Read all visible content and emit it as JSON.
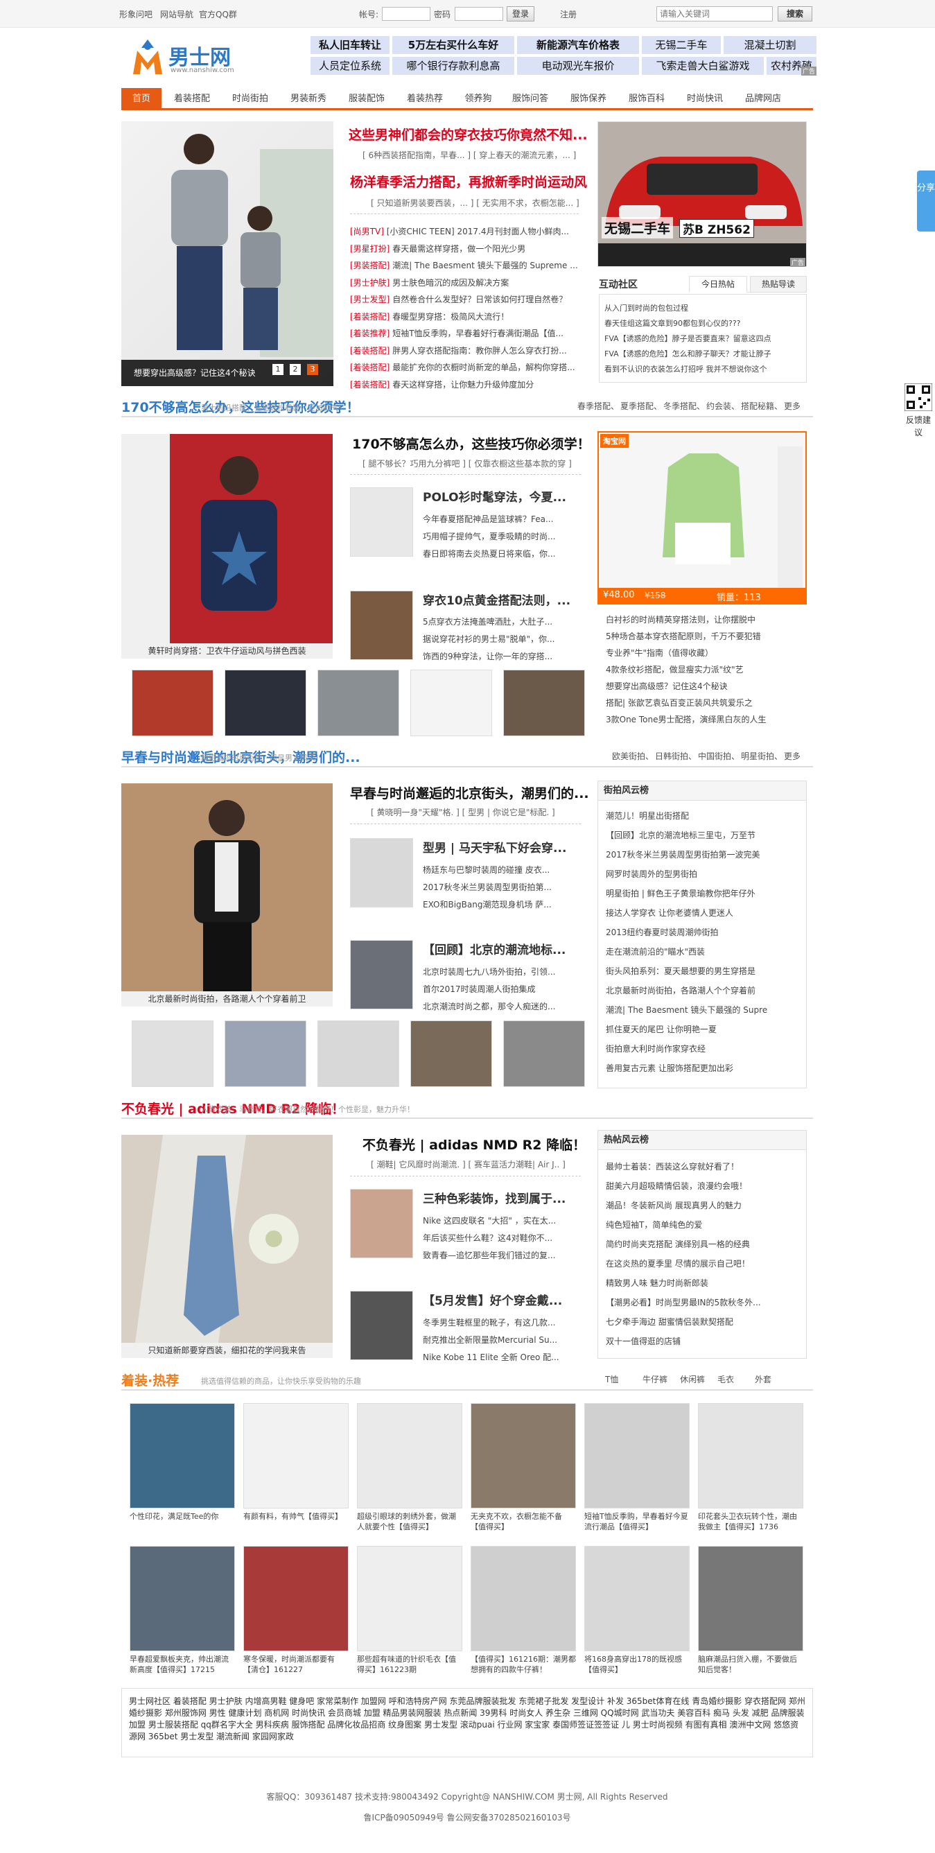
{
  "topbar": {
    "links": [
      "形象问吧",
      "网站导航",
      "官方QQ群"
    ],
    "account_label": "帐号:",
    "password_label": "密码",
    "login_btn": "登录",
    "register": "注册",
    "search_placeholder": "请输入关键词",
    "search_btn": "搜索"
  },
  "logo": {
    "text": "男士网",
    "sub": "www.nanshiw.com"
  },
  "hotlinks": [
    "私人旧车转让",
    "5万左右买什么车好",
    "新能源汽车价格表",
    "无锡二手车",
    "混凝土切割",
    "人员定位系统",
    "哪个银行存款利息高",
    "电动观光车报价",
    "飞索走兽大白鲨游戏",
    "农村养殖"
  ],
  "hot_ad": "广告",
  "nav": [
    "首页",
    "着装搭配",
    "时尚街拍",
    "男装新秀",
    "服装配饰",
    "着装热荐",
    "领养狗",
    "服饰问答",
    "服饰保养",
    "服饰百科",
    "时尚快讯",
    "品牌网店"
  ],
  "hero": {
    "caption": "想要穿出高级感？记住这4个秘诀",
    "dots": [
      "1",
      "2",
      "3"
    ],
    "title1": "这些男神们都会的穿衣技巧你竟然不知...",
    "sub1": "[ 6种西装搭配指南，早春... ]  [ 穿上春天的潮流元素，... ]",
    "title2": "杨洋春季活力搭配，再掀新季时尚运动风",
    "sub2": "[ 只知道新男装要西装，... ]  [ 无实用不求，衣橱怎能... ]",
    "items": [
      [
        "[尚男TV]",
        "[小资CHIC TEEN] 2017.4月刊封面人物小鲜肉..."
      ],
      [
        "[男星打扮]",
        "春天最需这样穿搭，做一个阳光少男"
      ],
      [
        "[男装搭配]",
        "潮流| The Baesment 镜头下最强的 Supreme ..."
      ],
      [
        "[男士护肤]",
        "男士肤色暗沉的成因及解决方案"
      ],
      [
        "[男士发型]",
        "自然卷合什么发型好？日常该如何打理自然卷？"
      ],
      [
        "[着装搭配]",
        "春暖型男穿搭：极简风大流行！"
      ],
      [
        "[着装推荐]",
        "短袖T恤反季购，早春着好行春满街潮品【值..."
      ],
      [
        "[着装搭配]",
        "胖男人穿衣搭配指南：教你胖人怎么穿衣打扮..."
      ],
      [
        "[着装搭配]",
        "最能扩充你的衣橱时尚新宠的单品，解构你穿搭..."
      ],
      [
        "[着装搭配]",
        "春天这样穿搭，让你魅力升级帅度加分"
      ]
    ]
  },
  "car": {
    "label": "无锡二手车",
    "plate": "苏B ZH562",
    "ad": "广告"
  },
  "community": {
    "title": "互动社区",
    "tabs": [
      "今日热帖",
      "热贴导读"
    ],
    "items": [
      "从入门到时尚的包包过程",
      "春天佳组这篇文章到90都包到心仪的???",
      "FVA【诱惑的危险】脖子是否要直来？留意这四点",
      "FVA【诱惑的危险】怎么和脖子聊天？才能让脖子",
      "看到不认识的衣装怎么打招呼 我并不想说你这个"
    ]
  },
  "s1": {
    "title": "170不够高怎么办，这些技巧你必须学！",
    "subtitle": "男士前沿搭配，让您轻松着装，更加帅气！",
    "links": [
      "春季搭配、",
      "夏季搭配、",
      "冬季搭配、",
      "约会装、",
      "搭配秘籍、",
      "更多"
    ],
    "main_cap": "黄轩时尚穿搭：卫衣牛仔运动风与拼色西装",
    "sub": "[ 腿不够长？巧用九分裤吧 ]  [ 仅靠衣橱这些基本款的穿 ]",
    "a1": {
      "title": "POLO衫时髦穿法，今夏...",
      "items": [
        "今年春夏搭配神品是篮球裤？Fea...",
        "巧用帽子提帅气，夏季吸睛的时尚...",
        "春日即将南去炎热夏日将来临，你..."
      ]
    },
    "a2": {
      "title": "穿衣10点黄金搭配法则，...",
      "items": [
        "5点穿衣方法掩盖啤酒肚，大肚子...",
        "据说穿花衬衫的男士易\"脱单\"，你...",
        "饰西的9种穿法，让你一年的穿搭..."
      ]
    },
    "taobao": {
      "logo": "淘宝网",
      "price": "¥48.00",
      "old": "¥158",
      "sales": "销量：113",
      "ad": "广告"
    },
    "right_list": [
      "白衬衫的时尚精英穿搭法则，让你摆脱中",
      "5种场合基本穿衣搭配原则，千万不要犯错",
      "专业养\"牛\"指南（值得收藏）",
      "4款条纹衫搭配，做显瘦实力派\"纹\"艺",
      "想要穿出高级感？记住这4个秘诀",
      "搭配| 张歆艺袁弘百变正装风共筑爱乐之",
      "3款One Tone男士配搭，演绎黑白灰的人生"
    ]
  },
  "s2": {
    "title": "早春与时尚邂逅的北京街头，潮男们的...",
    "subtitle": "精彩潮流时尚街拍，尽显男人风采！",
    "links": [
      "欧美街拍、",
      "日韩街拍、",
      "中国街拍、",
      "明星街拍、",
      "更多"
    ],
    "main_cap": "北京最新时尚街拍，各路潮人个个穿着前卫",
    "sub": "[ 黄晓明一身\"天耀\"格. ]  [ 型男 | 你说它是\"标配. ]",
    "a1": {
      "title": "型男 | 马天宇私下好会穿...",
      "items": [
        "杨廷东与巴黎时装周的碰撞 皮衣...",
        "2017秋冬米兰男装周型男街拍第...",
        "EXO和BigBang潮范现身机场 萨..."
      ]
    },
    "a2": {
      "title": "【回顾】北京的潮流地标...",
      "items": [
        "北京时装周七九八场外街拍，引领...",
        "首尔2017时装周潮人街拍集成",
        "北京潮流时尚之都，那令人痴迷的..."
      ]
    },
    "box_title": "街拍风云榜",
    "box_items": [
      "潮范儿！明星出街搭配",
      "【回顾】北京的潮流地标三里屯，万至节",
      "2017秋冬米兰男装周型男街拍第一波完美",
      "网罗时装周外的型男街拍",
      "明星街拍 | 鲜色王子黄景瑜教你把年仔外",
      "接达人学穿衣 让你老婆情人更迷人",
      "2013纽约春夏时装周潮帅街拍",
      "走在潮流前沿的\"瞄水\"西装",
      "街头风拍系列：夏天最想要的男生穿搭是",
      "北京最新时尚街拍，各路潮人个个穿着前",
      "潮流| The Baesment 镜头下最强的 Supre",
      "抓住夏天的尾巴 让你明艳一夏",
      "街拍意大利时尚作家穿衣经",
      "善用复古元素 让服饰搭配更加出彩"
    ]
  },
  "s3": {
    "title": "不负春光 | adidas NMD R2 降临！",
    "subtitle": "人靠衣装，马靠鞍。好衣服自然好配饰！个性彰显，魅力升华！",
    "main_cap": "只知道新郎要穿西装，细扣花的学问我来告",
    "sub": "[ 潮鞋| 它风靡时尚潮流. ]  [ 赛车蓝活力潮鞋| Air J.. ]",
    "a1": {
      "title": "三种色彩装饰，找到属于...",
      "items": [
        "Nike 这四皮联名 \"大招\" ，实在太...",
        "年后该买些什么鞋？这4对鞋你不...",
        "致青春—追忆那些年我们错过的复..."
      ]
    },
    "a2": {
      "title": "【5月发售】好个穿金戴...",
      "items": [
        "冬季男生鞋框里的靴子，有这几款...",
        "耐克推出全新限量款Mercurial Su...",
        "Nike Kobe 11 Elite 全新 Oreo 配..."
      ]
    },
    "box_title": "热帖风云榜",
    "box_items": [
      "最帅士着装：西装这么穿就好看了！",
      "甜美六月超吸睛情侣装，浪漫约会哦！",
      "潮品！冬装新风尚 展现真男人的魅力",
      "纯色短袖T，简单纯色的爱",
      "简约时尚夹克搭配 演绎别具一格的经典",
      "在这炎热的夏季里 尽情的展示自己吧！",
      "精致男人味 魅力时尚新郎装",
      "【潮男必看】时尚型男最IN的5款秋冬外...",
      "七夕牵手海边 甜蜜情侣装默契搭配",
      "双十一值得逛的店铺"
    ]
  },
  "s4": {
    "title": "着装·热荐",
    "subtitle": "挑选值得信赖的商品，让你快乐享受购物的乐趣",
    "links": [
      "T恤",
      "牛仔裤",
      "休闲裤",
      "毛衣",
      "外套"
    ],
    "row1": [
      "个性印花，满足既Tee的你",
      "有颜有料，有帅气【值得买】",
      "超级引眼球的刺绣外套，做潮人就要个性【值得买】",
      "无夹克不欢，衣橱怎能不备【值得买】",
      "短袖T恤反季购，早春着好今夏流行潮品【值得买】",
      "印花套头卫衣玩转个性，潮由我做主【值得买】1736"
    ],
    "row2": [
      "早春超爱飘板夹克，帅出潮流新高度【值得买】17215",
      "寒冬保暖，时尚潮派都要有【清仓】161227",
      "那些超有味道的针织毛衣【值得买】161223期",
      "【值得买】161216期：潮男都想拥有的四款牛仔裤！",
      "将168身高穿出178的既视感【值得买】",
      "脑麻潮品扫货入棚，不要做后知后觉客！"
    ]
  },
  "footer": {
    "links": "男士网社区  着装搭配  男士护肤  内增高男鞋  健身吧  家常菜制作  加盟网  呼和浩特房产网  东莞品牌服装批发  东莞裙子批发  发型设计  补发  365bet体育在线  青岛婚纱摄影  穿衣搭配网  郑州婚纱摄影  郑州服饰网  男性  健康计划  商机网  时尚快讯  会员商城  加盟  精品男装网服装  热点新闻  39男科  时尚女人  养生杂  三维网  QQ城时网  武当功夫  美容百科  痴马  头发  减肥  品牌服装加盟  男士服装搭配  qq群名字大全  男科疾病  服饰搭配  品牌化妆品招商  纹身图案  男士发型  滚动puai  行业网  家宝家  泰国师签证签签证  儿  男士时尚视频  有图有真相  澳洲中文网  悠悠资源网  365bet  男士发型  潮流新闻  家园网家政",
    "line1": "客服QQ：309361487    技术支持:980043492    Copyright@ NANSHIW.COM 男士网, All Rights Reserved",
    "line2": "鲁ICP备09050949号   鲁公网安备37028502160103号"
  },
  "side": {
    "share": "分享",
    "feedback": "反馈建议"
  }
}
